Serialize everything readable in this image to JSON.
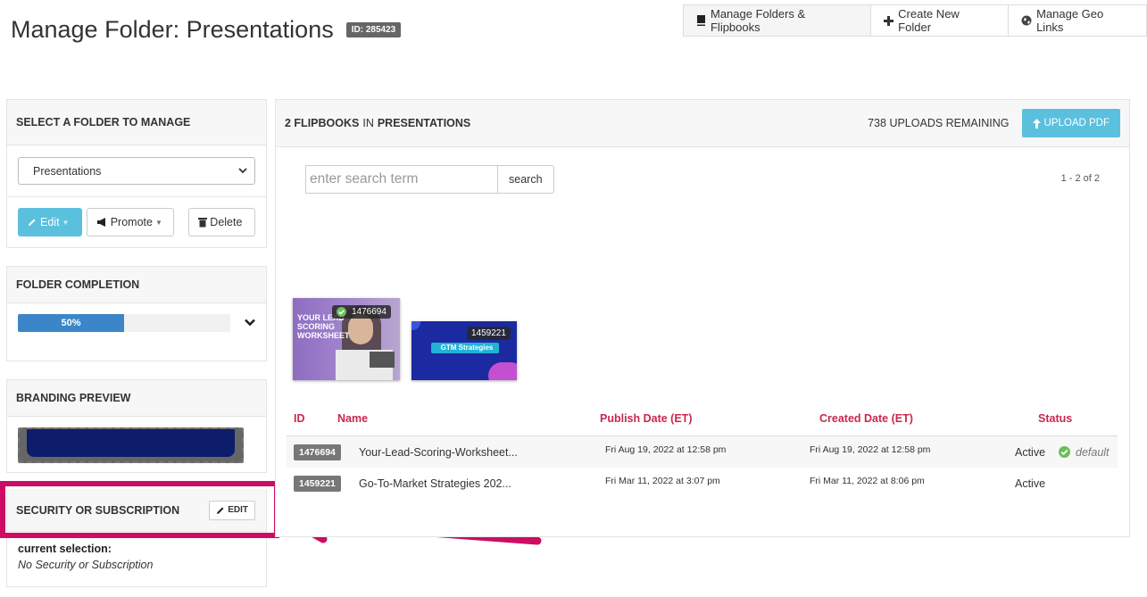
{
  "header": {
    "title": "Manage Folder: Presentations",
    "id_badge": "ID: 285423"
  },
  "top_buttons": [
    {
      "label": "Manage Folders & Flipbooks",
      "icon": "book-icon"
    },
    {
      "label": "Create New Folder",
      "icon": "plus-icon"
    },
    {
      "label": "Manage Geo Links",
      "icon": "globe-icon"
    }
  ],
  "folder_panel": {
    "title": "SELECT A FOLDER TO MANAGE",
    "selected_folder": "Presentations",
    "edit_label": "Edit",
    "promote_label": "Promote",
    "delete_label": "Delete"
  },
  "completion_panel": {
    "title": "FOLDER COMPLETION",
    "progress_label": "50%",
    "progress_value": 0.5
  },
  "branding_panel": {
    "title": "BRANDING PREVIEW"
  },
  "security_panel": {
    "title": "SECURITY OR SUBSCRIPTION",
    "edit_label": "EDIT",
    "current_selection_label": "current selection:",
    "current_selection_value": "No Security or Subscription"
  },
  "main": {
    "count": "2 FLIPBOOKS",
    "in_word": "IN",
    "folder_name": "PRESENTATIONS",
    "uploads_remaining": "738 UPLOADS REMAINING",
    "upload_label": "UPLOAD PDF",
    "search_placeholder": "enter search term",
    "search_button": "search",
    "pager": "1 - 2 of 2"
  },
  "thumbnails": [
    {
      "id": "1476694",
      "title_text": "YOUR LEAD SCORING WORKSHEET"
    },
    {
      "id": "1459221",
      "title_text": "GTM Strategies"
    }
  ],
  "table": {
    "headers": {
      "id": "ID",
      "name": "Name",
      "publish": "Publish Date (ET)",
      "created": "Created Date (ET)",
      "status": "Status"
    },
    "rows": [
      {
        "id": "1476694",
        "name": "Your-Lead-Scoring-Worksheet...",
        "publish": "Fri Aug 19, 2022 at 12:58 pm",
        "created": "Fri Aug 19, 2022 at 12:58 pm",
        "status": "Active",
        "default_label": "default"
      },
      {
        "id": "1459221",
        "name": "Go-To-Market Strategies 202...",
        "publish": "Fri Mar 11, 2022 at 3:07 pm",
        "created": "Fri Mar 11, 2022 at 8:06 pm",
        "status": "Active"
      }
    ]
  },
  "colors": {
    "info": "#5bc0de",
    "progress": "#3a86c8",
    "table_header": "#c9274f",
    "annotation": "#cc0d63"
  }
}
